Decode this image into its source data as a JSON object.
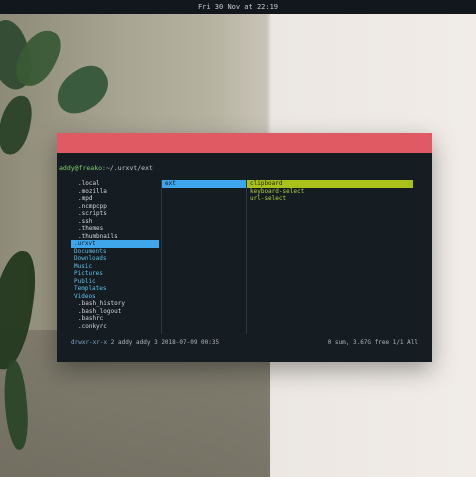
{
  "topbar": {
    "datetime": "Fri 30 Nov at 22:19"
  },
  "terminal": {
    "prompt_user": "addy@freako",
    "prompt_path": ":~/.urxvt/ext",
    "left_pane": [
      {
        "label": ".local",
        "kind": "hidden"
      },
      {
        "label": ".mozilla",
        "kind": "hidden"
      },
      {
        "label": ".mpd",
        "kind": "hidden"
      },
      {
        "label": ".ncmpcpp",
        "kind": "hidden"
      },
      {
        "label": ".scripts",
        "kind": "hidden"
      },
      {
        "label": ".ssh",
        "kind": "hidden"
      },
      {
        "label": ".themes",
        "kind": "hidden"
      },
      {
        "label": ".thumbnails",
        "kind": "hidden"
      },
      {
        "label": ".urxvt",
        "kind": "selected"
      },
      {
        "label": "Documents",
        "kind": "dir"
      },
      {
        "label": "Downloads",
        "kind": "dir"
      },
      {
        "label": "Music",
        "kind": "dir"
      },
      {
        "label": "Pictures",
        "kind": "dir"
      },
      {
        "label": "Public",
        "kind": "dir"
      },
      {
        "label": "Templates",
        "kind": "dir"
      },
      {
        "label": "Videos",
        "kind": "dir"
      },
      {
        "label": ".bash_history",
        "kind": "hidden"
      },
      {
        "label": ".bash_logout",
        "kind": "hidden"
      },
      {
        "label": ".bashrc",
        "kind": "hidden"
      },
      {
        "label": ".conkyrc",
        "kind": "hidden"
      }
    ],
    "mid_pane": [
      {
        "label": "ext",
        "kind": "selected"
      }
    ],
    "right_pane": [
      {
        "label": "clipboard",
        "kind": "selected-green"
      },
      {
        "label": "keyboard-select",
        "kind": "green"
      },
      {
        "label": "url-select",
        "kind": "green"
      }
    ],
    "status": {
      "permissions": "drwxr-xr-x",
      "info": "2 addy addy 3 2018-07-09 00:35",
      "right": "0 sum, 3.67G free  1/1  All"
    }
  },
  "colors": {
    "titlebar": "#e05a64",
    "terminal_bg": "#151d23",
    "selection_blue": "#3fa6ec",
    "selection_green": "#a9c11a"
  }
}
